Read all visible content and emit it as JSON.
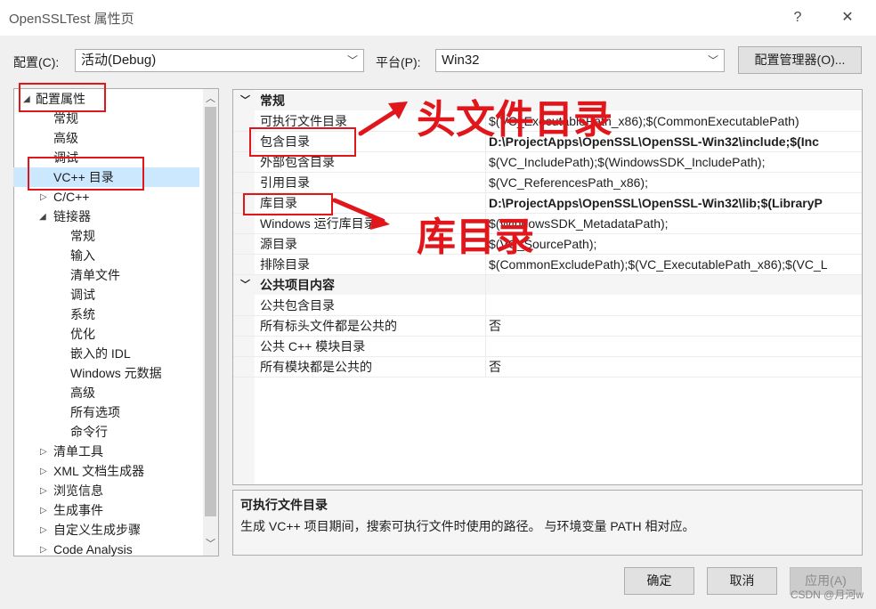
{
  "window": {
    "title": "OpenSSLTest 属性页",
    "help": "?",
    "close": "✕"
  },
  "toolbar": {
    "config_label": "配置(C):",
    "config_value": "活动(Debug)",
    "platform_label": "平台(P):",
    "platform_value": "Win32",
    "config_manager": "配置管理器(O)..."
  },
  "tree": {
    "root": "配置属性",
    "items": [
      "常规",
      "高级",
      "调试",
      "VC++ 目录",
      "C/C++",
      "链接器",
      "常规",
      "输入",
      "清单文件",
      "调试",
      "系统",
      "优化",
      "嵌入的 IDL",
      "Windows 元数据",
      "高级",
      "所有选项",
      "命令行",
      "清单工具",
      "XML 文档生成器",
      "浏览信息",
      "生成事件",
      "自定义生成步骤",
      "Code Analysis"
    ]
  },
  "grid": {
    "cat1": "常规",
    "rows1": [
      {
        "name": "可执行文件目录",
        "value": "$(VC_ExecutablePath_x86);$(CommonExecutablePath)"
      },
      {
        "name": "包含目录",
        "value": "D:\\ProjectApps\\OpenSSL\\OpenSSL-Win32\\include;$(Inc"
      },
      {
        "name": "外部包含目录",
        "value": "$(VC_IncludePath);$(WindowsSDK_IncludePath);"
      },
      {
        "name": "引用目录",
        "value": "$(VC_ReferencesPath_x86);"
      },
      {
        "name": "库目录",
        "value": "D:\\ProjectApps\\OpenSSL\\OpenSSL-Win32\\lib;$(LibraryP"
      },
      {
        "name": "Windows 运行库目录",
        "value": "$(WindowsSDK_MetadataPath);"
      },
      {
        "name": "源目录",
        "value": "$(VC_SourcePath);"
      },
      {
        "name": "排除目录",
        "value": "$(CommonExcludePath);$(VC_ExecutablePath_x86);$(VC_L"
      }
    ],
    "cat2": "公共项目内容",
    "rows2": [
      {
        "name": "公共包含目录",
        "value": ""
      },
      {
        "name": "所有标头文件都是公共的",
        "value": "否"
      },
      {
        "name": "公共 C++ 模块目录",
        "value": ""
      },
      {
        "name": "所有模块都是公共的",
        "value": "否"
      }
    ]
  },
  "description": {
    "title": "可执行文件目录",
    "text": "生成 VC++ 项目期间，搜索可执行文件时使用的路径。 与环境变量 PATH 相对应。"
  },
  "buttons": {
    "ok": "确定",
    "cancel": "取消",
    "apply": "应用(A)"
  },
  "annotations": {
    "include_label": "头文件目录",
    "lib_label": "库目录",
    "color": "#e0161b"
  },
  "watermark": "CSDN @月河w"
}
